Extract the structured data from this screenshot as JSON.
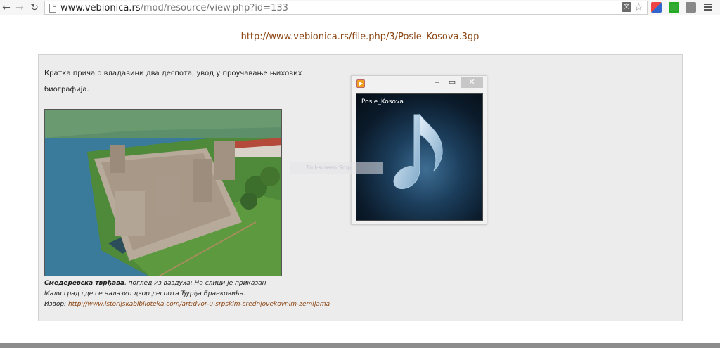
{
  "browser": {
    "url_host": "www.vebionica.rs",
    "url_path": "/mod/resource/view.php?id=133",
    "icons": {
      "back": "back-arrow-icon",
      "forward": "forward-arrow-icon",
      "reload": "reload-icon",
      "page": "page-icon",
      "translate": "translate-icon",
      "star": "bookmark-star-icon",
      "menu": "menu-icon"
    }
  },
  "page": {
    "file_link": "http://www.vebionica.rs/file.php/3/Posle_Kosova.3gp",
    "description": "Кратка прича о владавини два деспота, увод у проучавање њихових биографија.",
    "caption": {
      "title": "Смедеревска тврђава",
      "line1_rest": ", поглед из ваздуха; На слици је приказан",
      "line2": "Мали град где се налазио двор деспота Ђурђа Бранковића.",
      "source_label": "Извор: ",
      "source_url": "http://www.istorijskabiblioteka.com/art:dvor-u-srpskim-srednjovekovnim-zemljama"
    }
  },
  "player": {
    "title": "Posle_Kosova",
    "controls": {
      "minimize": "‒",
      "maximize": "▭",
      "close": "✕"
    }
  },
  "overlay": {
    "snip_label": "Full-screen Snip"
  },
  "colors": {
    "link": "#8b4513",
    "content_bg": "#ececec",
    "player_close_bg": "#c7c7c7"
  }
}
